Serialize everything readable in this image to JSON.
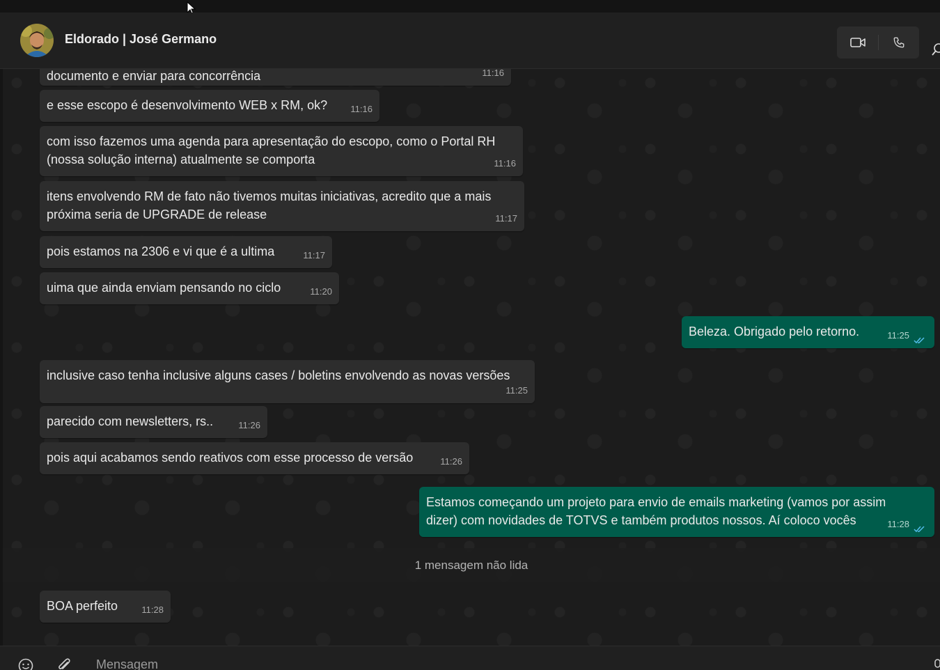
{
  "header": {
    "contact_name": "Eldorado | José Germano"
  },
  "messages": [
    {
      "dir": "in",
      "text": "documento e enviar para concorrência",
      "time": "11:16"
    },
    {
      "dir": "in",
      "text": "e esse escopo é desenvolvimento WEB x RM, ok?",
      "time": "11:16"
    },
    {
      "dir": "in",
      "text": "com isso fazemos uma agenda para apresentação do escopo, como o Portal RH\n(nossa solução interna) atualmente se comporta",
      "time": "11:16"
    },
    {
      "dir": "in",
      "text": "itens envolvendo RM de fato não tivemos muitas iniciativas, acredito que a mais\npróxima seria de UPGRADE de release",
      "time": "11:17"
    },
    {
      "dir": "in",
      "text": "pois estamos na 2306 e vi que é a ultima",
      "time": "11:17"
    },
    {
      "dir": "in",
      "text": "uima que ainda enviam pensando no ciclo",
      "time": "11:20"
    },
    {
      "dir": "out",
      "text": "Beleza. Obrigado pelo retorno.",
      "time": "11:25",
      "status": "read"
    },
    {
      "dir": "in",
      "text": "inclusive caso tenha inclusive alguns cases / boletins envolvendo as novas versões",
      "time": "11:25"
    },
    {
      "dir": "in",
      "text": "parecido com newsletters, rs..",
      "time": "11:26"
    },
    {
      "dir": "in",
      "text": "pois aqui acabamos sendo reativos com esse processo de versão",
      "time": "11:26"
    },
    {
      "dir": "out",
      "text": "Estamos começando um projeto para envio de emails marketing (vamos por assim\ndizer) com novidades de TOTVS e também produtos nossos. Aí coloco vocês",
      "time": "11:28",
      "status": "read"
    },
    {
      "dir": "in",
      "text": "BOA perfeito",
      "time": "11:28"
    }
  ],
  "unread_divider": "1 mensagem não lida",
  "composer": {
    "placeholder": "Mensagem"
  },
  "colors": {
    "incoming_bubble": "#2d2d2d",
    "outgoing_bubble": "#005c4b",
    "read_ticks": "#53bdeb"
  },
  "icons": [
    "video-call-icon",
    "voice-call-icon",
    "search-icon",
    "emoji-icon",
    "attach-icon",
    "mic-icon"
  ]
}
